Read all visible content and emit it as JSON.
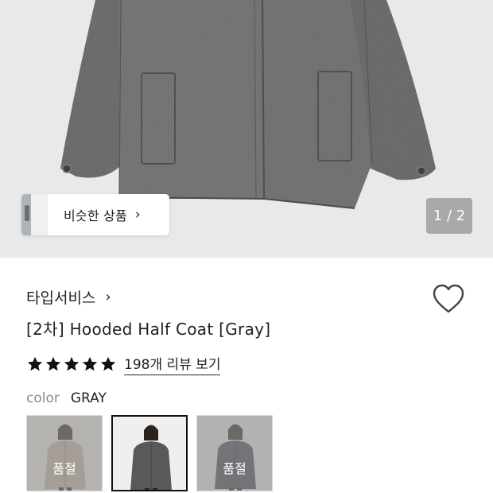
{
  "hero": {
    "image_icon": "gray-wool-coat-photo",
    "similar_products": {
      "label": "비슷한 상품",
      "chevron": "›"
    },
    "pager": "1 / 2"
  },
  "product": {
    "brand": "타입서비스",
    "brand_chevron": "›",
    "name": "[2차] Hooded Half Coat [Gray]",
    "wishlist_icon": "heart-outline-icon",
    "rating": {
      "stars": 5,
      "max": 5,
      "reviews_label": "198개 리뷰 보기"
    },
    "color": {
      "label": "color",
      "value": "GRAY"
    },
    "swatches": [
      {
        "name": "beige",
        "soldout": true,
        "soldout_label": "품절",
        "colors": {
          "bg": "#cfcac4",
          "coat": "#a99c8c"
        }
      },
      {
        "name": "gray",
        "soldout": false,
        "selected": true,
        "colors": {
          "bg": "#f1efed",
          "coat": "#58595a"
        }
      },
      {
        "name": "charcoal",
        "soldout": true,
        "soldout_label": "품절",
        "colors": {
          "bg": "#c8c8c8",
          "coat": "#3c3f45"
        }
      }
    ]
  },
  "colors": {
    "accent": "#222222",
    "pager_bg": "#a9a9a9",
    "muted": "#8a8a8a"
  }
}
